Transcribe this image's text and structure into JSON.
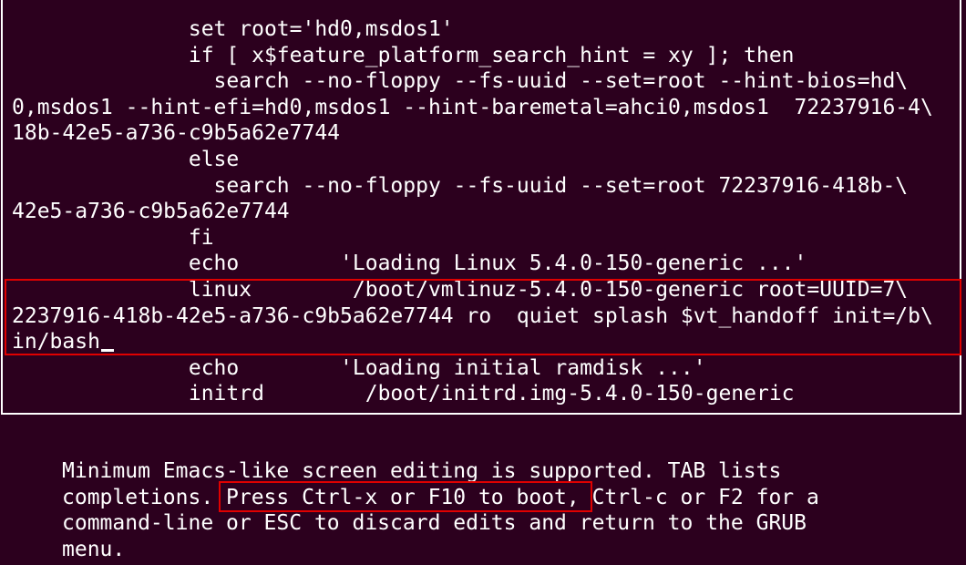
{
  "editor": {
    "lines": [
      "              set root='hd0,msdos1'",
      "              if [ x$feature_platform_search_hint = xy ]; then",
      "                search --no-floppy --fs-uuid --set=root --hint-bios=hd\\",
      "0,msdos1 --hint-efi=hd0,msdos1 --hint-baremetal=ahci0,msdos1  72237916-4\\",
      "18b-42e5-a736-c9b5a62e7744",
      "              else",
      "                search --no-floppy --fs-uuid --set=root 72237916-418b-\\",
      "42e5-a736-c9b5a62e7744",
      "              fi",
      "              echo        'Loading Linux 5.4.0-150-generic ...'",
      "              linux        /boot/vmlinuz-5.4.0-150-generic root=UUID=7\\",
      "2237916-418b-42e5-a736-c9b5a62e7744 ro  quiet splash $vt_handoff init=/b\\",
      "in/bash",
      "              echo        'Loading initial ramdisk ...'",
      "              initrd        /boot/initrd.img-5.4.0-150-generic"
    ]
  },
  "help": {
    "lines": [
      "Minimum Emacs-like screen editing is supported. TAB lists",
      "completions. Press Ctrl-x or F10 to boot, Ctrl-c or F2 for a",
      "command-line or ESC to discard edits and return to the GRUB",
      "menu."
    ]
  },
  "colors": {
    "background": "#2c001e",
    "text": "#ffffff",
    "highlight": "#e00000"
  }
}
